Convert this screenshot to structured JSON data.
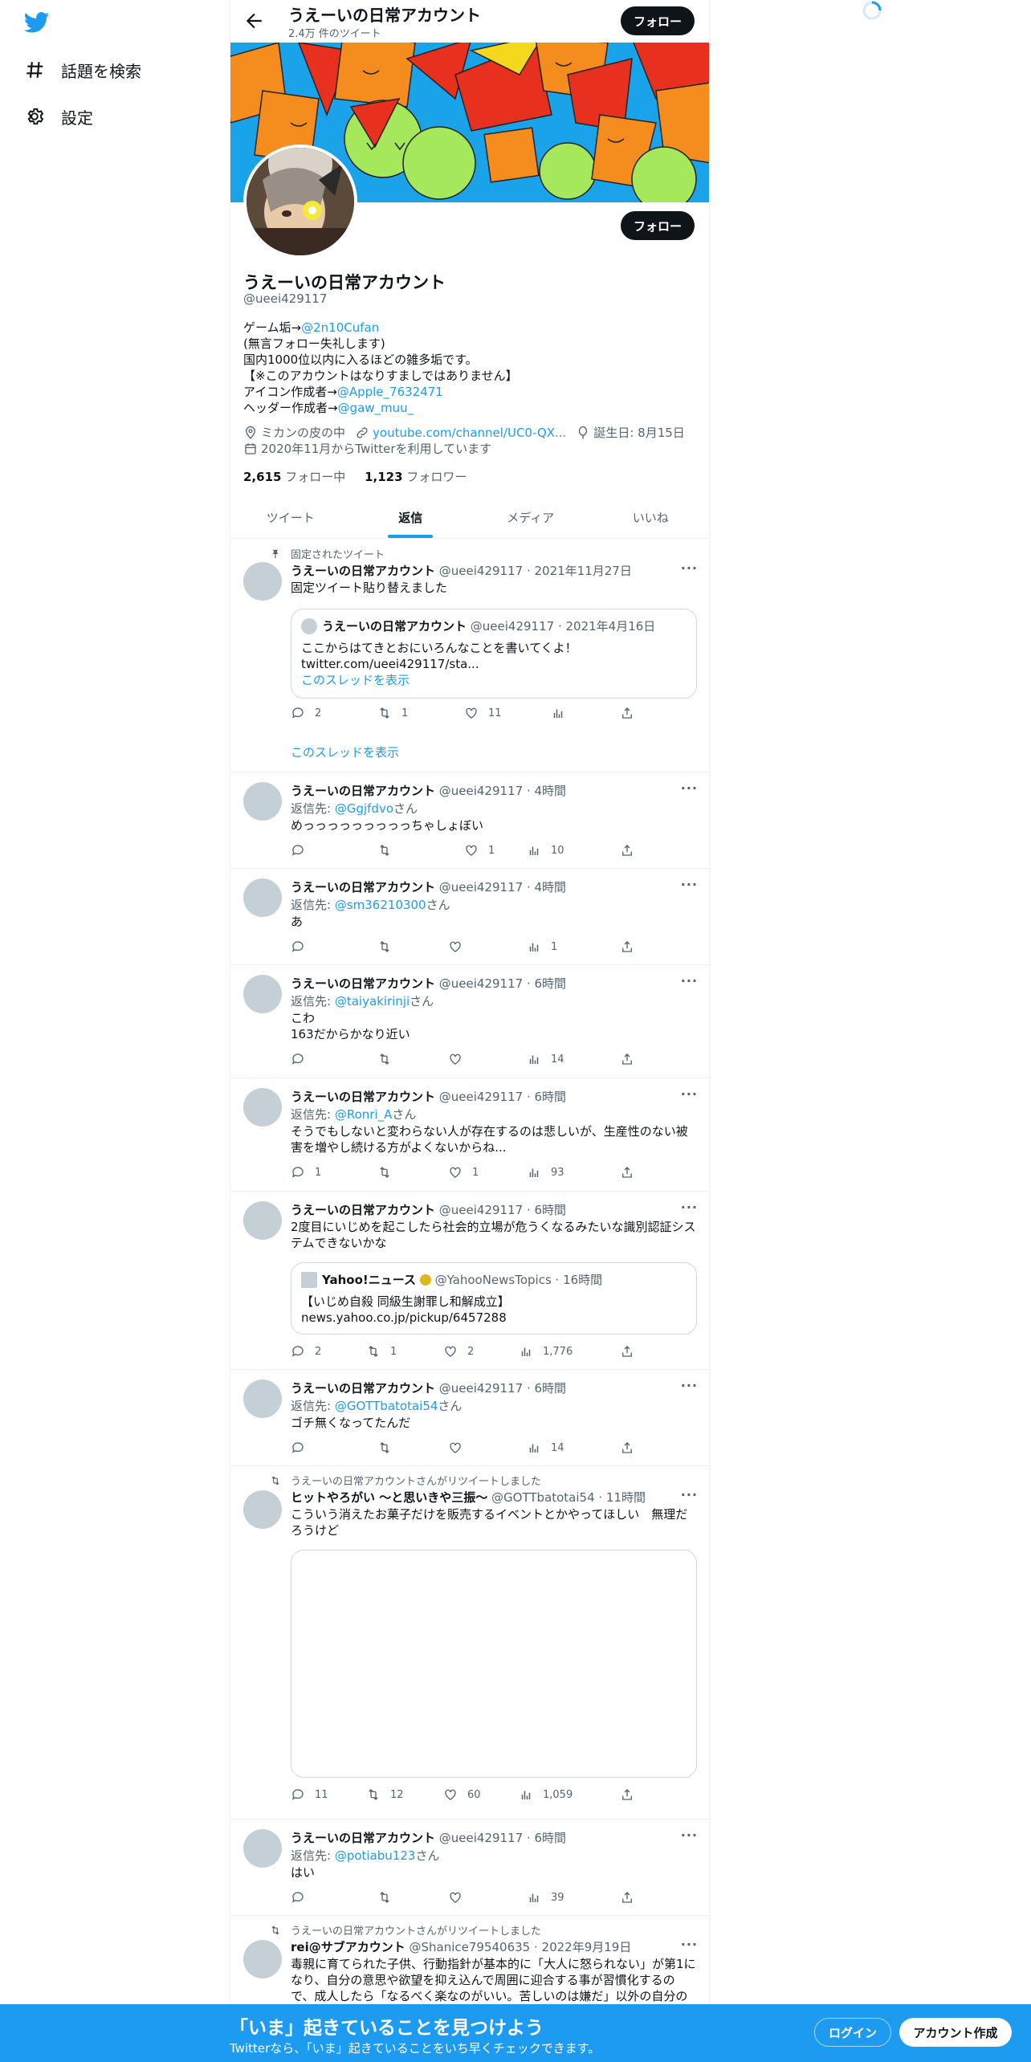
{
  "nav": {
    "explore_label": "話題を検索",
    "settings_label": "設定"
  },
  "header": {
    "name": "うえーいの日常アカウント",
    "tweet_count": "2.4万 件のツイート",
    "follow_label": "フォロー"
  },
  "profile": {
    "name": "うえーいの日常アカウント",
    "handle": "@ueei429117",
    "follow_label": "フォロー",
    "bio": {
      "line1_prefix": "ゲーム垢→",
      "line1_link": "@2n10Cufan",
      "line2": "(無言フォロー失礼します)",
      "line3": "国内1000位以内に入るほどの雑多垢です。",
      "line4": "【※このアカウントはなりすましではありません】",
      "line5_prefix": "アイコン作成者→",
      "line5_link": "@Apple_7632471",
      "line6_prefix": "ヘッダー作成者→",
      "line6_link": "@gaw_muu_"
    },
    "location": "ミカンの皮の中",
    "website": "youtube.com/channel/UC0-QX...",
    "birthday": "誕生日: 8月15日",
    "joined": "2020年11月からTwitterを利用しています",
    "following_count": "2,615",
    "following_label": "フォロー中",
    "followers_count": "1,123",
    "followers_label": "フォロワー"
  },
  "tabs": [
    "ツイート",
    "返信",
    "メディア",
    "いいね"
  ],
  "active_tab": "返信",
  "tweets": [
    {
      "social": "固定されたツイート",
      "name": "うえーいの日常アカウント",
      "meta": "@ueei429117 · 2021年11月27日",
      "text": "固定ツイート貼り替えました",
      "quote": {
        "name": "うえーいの日常アカウント",
        "meta": "@ueei429117 · 2021年4月16日",
        "line1": "ここからはてきとおにいろんなことを書いてくよ！",
        "line2": "twitter.com/ueei429117/sta...",
        "thread": "このスレッドを表示"
      },
      "replies": "2",
      "retweets": "1",
      "likes": "11",
      "show_thread": "このスレッドを表示"
    },
    {
      "name": "うえーいの日常アカウント",
      "meta": "@ueei429117 · 4時間",
      "reply_prefix": "返信先: ",
      "reply_to": "@Ggjfdvo",
      "reply_suffix": "さん",
      "text": "めっっっっっっっっっちゃしょぼい",
      "likes": "1",
      "views": "10"
    },
    {
      "name": "うえーいの日常アカウント",
      "meta": "@ueei429117 · 4時間",
      "reply_prefix": "返信先: ",
      "reply_to": "@sm36210300",
      "reply_suffix": "さん",
      "text": "あ",
      "views": "1"
    },
    {
      "name": "うえーいの日常アカウント",
      "meta": "@ueei429117 · 6時間",
      "reply_prefix": "返信先: ",
      "reply_to": "@taiyakirinji",
      "reply_suffix": "さん",
      "text1": "こわ",
      "text2": "163だからかなり近い",
      "views": "14"
    },
    {
      "name": "うえーいの日常アカウント",
      "meta": "@ueei429117 · 6時間",
      "reply_prefix": "返信先: ",
      "reply_to": "@Ronri_A",
      "reply_suffix": "さん",
      "text1": "そうでもしないと変わらない人が存在するのは悲しいが、生産性のない被",
      "text2": "害を増やし続ける方がよくないからね...",
      "replies": "1",
      "likes": "1",
      "views": "93"
    },
    {
      "name": "うえーいの日常アカウント",
      "meta": "@ueei429117 · 6時間",
      "text1": "2度目にいじめを起こしたら社会的立場が危うくなるみたいな識別認証シス",
      "text2": "テムできないかな",
      "quote": {
        "name": "Yahoo!ニュース",
        "meta": "@YahooNewsTopics · 16時間",
        "line1": "【いじめ自殺 同級生謝罪し和解成立】",
        "line2": "news.yahoo.co.jp/pickup/6457288"
      },
      "replies": "2",
      "retweets": "1",
      "likes": "2",
      "views": "1,776"
    },
    {
      "name": "うえーいの日常アカウント",
      "meta": "@ueei429117 · 6時間",
      "reply_prefix": "返信先: ",
      "reply_to": "@GOTTbatotai54",
      "reply_suffix": "さん",
      "text": "ゴチ無くなってたんだ",
      "views": "14"
    },
    {
      "social": "うえーいの日常アカウントさんがリツイートしました",
      "name": "ヒットやろがい 〜と思いきや三振〜",
      "meta": "@GOTTbatotai54 · 11時間",
      "text1": "こういう消えたお菓子だけを販売するイベントとかやってほしい　無理だ",
      "text2": "ろうけど",
      "replies": "11",
      "retweets": "12",
      "likes": "60",
      "views": "1,059"
    },
    {
      "name": "うえーいの日常アカウント",
      "meta": "@ueei429117 · 6時間",
      "reply_prefix": "返信先: ",
      "reply_to": "@potiabu123",
      "reply_suffix": "さん",
      "text": "はい",
      "views": "39"
    },
    {
      "social": "うえーいの日常アカウントさんがリツイートしました",
      "name": "rei@サブアカウント",
      "meta": "@Shanice79540635 · 2022年9月19日",
      "text1": "毒親に育てられた子供、行動指針が基本的に「大人に怒られない」が第1に",
      "text2": "なり、自分の意思や欲望を抑え込んで周囲に迎合する事が習慣化するの",
      "text3": "で、成人したら「なるべく楽なのがいい。苦しいのは嫌だ」以外の自分の"
    }
  ],
  "bottom": {
    "title": "「いま」起きていることを見つけよう",
    "subtitle": "Twitterなら、「いま」起きていることをいち早くチェックできます。",
    "login": "ログイン",
    "signup": "アカウント作成"
  },
  "colors": {
    "accent": "#1d9bf0",
    "text": "#0f1419",
    "secondary": "#536471"
  }
}
